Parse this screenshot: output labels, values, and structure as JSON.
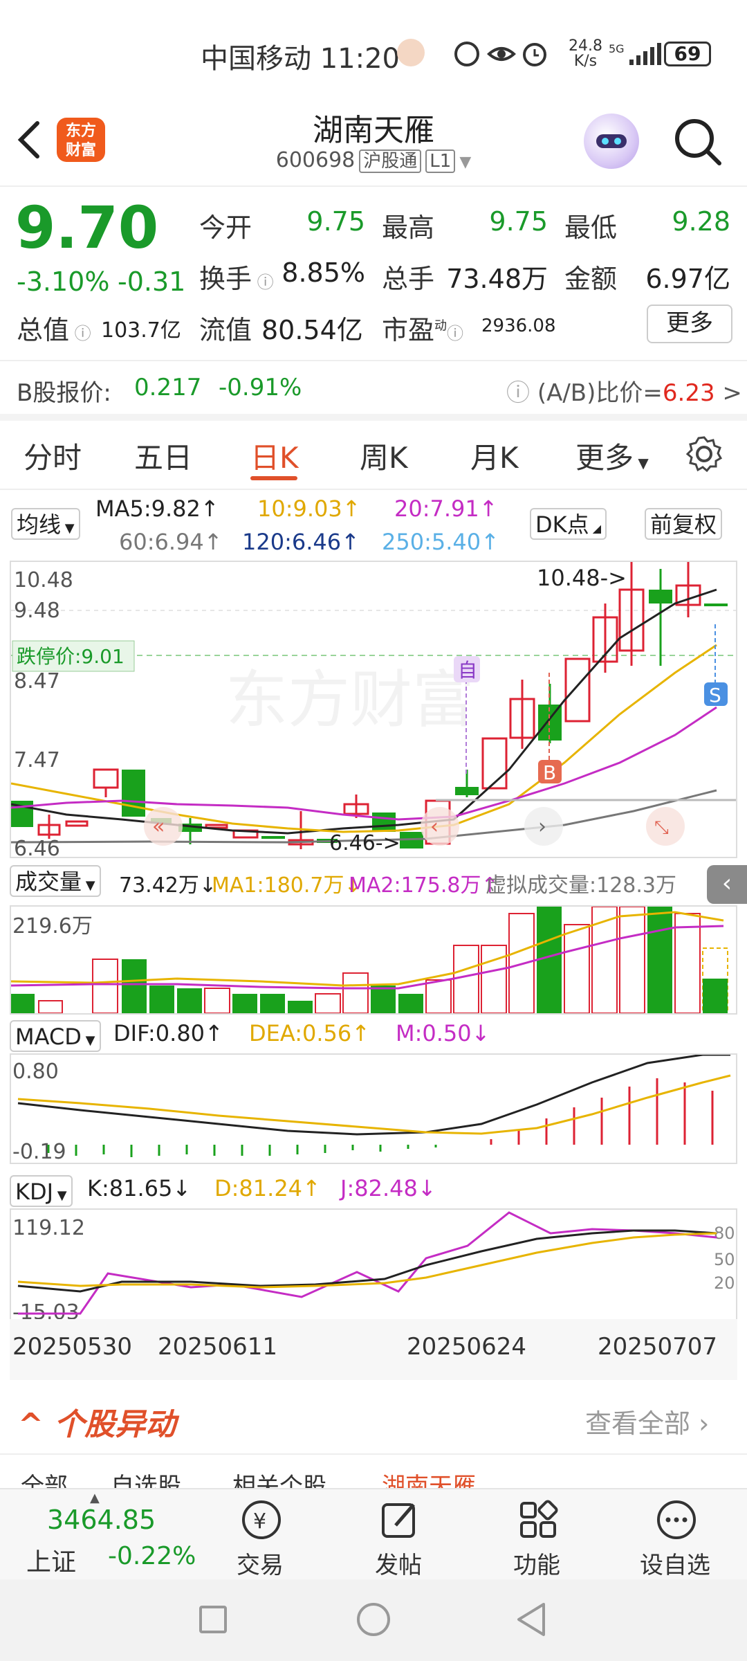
{
  "status_bar": {
    "carrier_time": "中国移动 11:20",
    "net_speed_top": "24.8",
    "net_speed_bottom": "K/s",
    "battery": "69"
  },
  "header": {
    "logo_line1": "东方",
    "logo_line2": "财富",
    "stock_name": "湖南天雁",
    "stock_code": "600698",
    "tag1": "沪股通",
    "tag2": "L1"
  },
  "quote": {
    "price": "9.70",
    "change_pct": "-3.10%",
    "change": "-0.31",
    "open_label": "今开",
    "open": "9.75",
    "high_label": "最高",
    "high": "9.75",
    "low_label": "最低",
    "low": "9.28",
    "turnover_label": "换手",
    "turnover": "8.85%",
    "volume_label": "总手",
    "volume": "73.48万",
    "amount_label": "金额",
    "amount": "6.97亿",
    "total_value_label": "总值",
    "total_value": "103.7亿",
    "float_value_label": "流值",
    "float_value": "80.54亿",
    "pe_label": "市盈",
    "pe_sup": "动",
    "pe": "2936.08",
    "more": "更多"
  },
  "bshare": {
    "label": "B股报价:",
    "price": "0.217",
    "change": "-0.91%",
    "ratio_label": "(A/B)比价=",
    "ratio": "6.23",
    "arrow": ">"
  },
  "tabs": [
    {
      "label": "分时"
    },
    {
      "label": "五日"
    },
    {
      "label": "日K"
    },
    {
      "label": "周K"
    },
    {
      "label": "月K"
    },
    {
      "label": "更多"
    }
  ],
  "ma": {
    "selector": "均线",
    "ma5": "MA5:9.82↑",
    "ma10": "10:9.03↑",
    "ma20": "20:7.91↑",
    "ma60": "60:6.94↑",
    "ma120": "120:6.46↑",
    "ma250": "250:5.40↑",
    "dk": "DK点",
    "fq": "前复权"
  },
  "kline": {
    "y_top": "10.48",
    "y_mid1": "9.48",
    "y_mid2": "8.47",
    "y_mid3": "7.47",
    "y_bottom": "6.46",
    "limit_down": "跌停价:9.01",
    "max_marker": "10.48->",
    "min_marker": "6.46->",
    "mark_zi": "自",
    "mark_b": "B",
    "mark_s": "S",
    "watermark": "东方财富"
  },
  "volume": {
    "selector": "成交量",
    "value": "73.42万↓",
    "ma1": "MA1:180.7万↓",
    "ma2": "MA2:175.8万↑",
    "virtual": "虚拟成交量:128.3万",
    "axis": "219.6万"
  },
  "macd": {
    "selector": "MACD",
    "dif": "DIF:0.80↑",
    "dea": "DEA:0.56↑",
    "m": "M:0.50↓",
    "axis_top": "0.80",
    "axis_bottom": "-0.19"
  },
  "kdj": {
    "selector": "KDJ",
    "k": "K:81.65↓",
    "d": "D:81.24↑",
    "j": "J:82.48↓",
    "axis_top": "119.12",
    "axis_bottom": "-15.03",
    "lvl80": "80",
    "lvl50": "50",
    "lvl20": "20"
  },
  "dates": [
    "20250530",
    "20250611",
    "20250624",
    "20250707"
  ],
  "movement": {
    "title": "个股异动",
    "view_all": "查看全部",
    "subtabs": [
      "全部",
      "自选股",
      "相关个股",
      "湖南天雁"
    ]
  },
  "bottom_nav": {
    "index_value": "3464.85",
    "index_name": "上证",
    "index_change": "-0.22%",
    "items": [
      {
        "label": "交易"
      },
      {
        "label": "发帖"
      },
      {
        "label": "功能"
      },
      {
        "label": "设自选"
      }
    ]
  }
}
